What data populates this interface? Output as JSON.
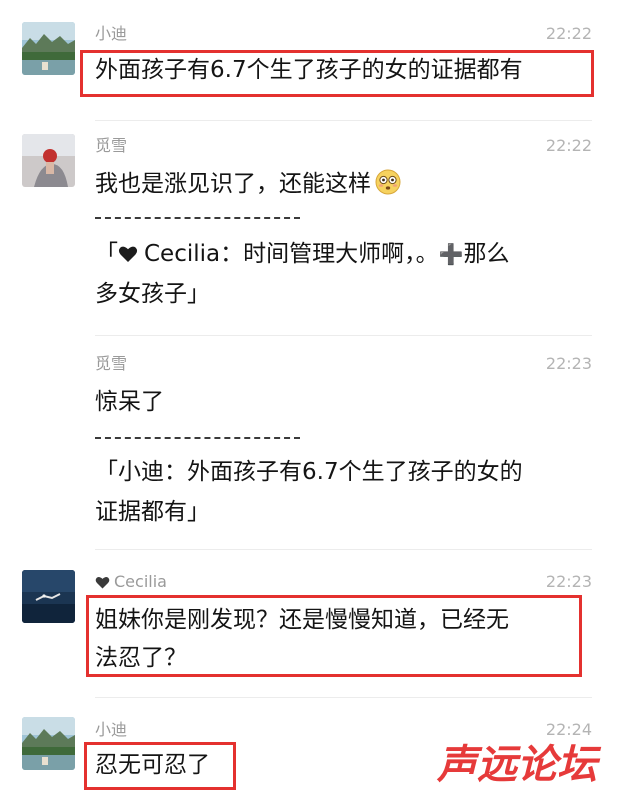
{
  "messages": [
    {
      "sender": "小迪",
      "time": "22:22",
      "text": "外面孩子有6.7个生了孩子的女的证据都有",
      "avatar_icon": "landscape-avatar-icon",
      "highlighted": true
    },
    {
      "sender": "觅雪",
      "time": "22:22",
      "text": "我也是涨见识了，还能这样",
      "emoji_icon": "flushed-face-emoji-icon",
      "divider": "---------------",
      "quote_line1_prefix": "「",
      "quote_line1_name": "Cecilia：时间管理大师啊，。",
      "quote_line1_plus": "➕",
      "quote_line1_rest": "那么",
      "quote_line2": "多女孩子」",
      "avatar_icon": "portrait-avatar-icon"
    },
    {
      "sender": "觅雪",
      "time": "22:23",
      "text": "惊呆了",
      "divider": "---------------",
      "quote_line1": "「小迪：外面孩子有6.7个生了孩子的女的",
      "quote_line2": "证据都有」"
    },
    {
      "sender": "Cecilia",
      "sender_icon": "black-heart-icon",
      "time": "22:23",
      "text_line1": "姐妹你是刚发现？还是慢慢知道，已经无",
      "text_line2": "法忍了？",
      "avatar_icon": "ocean-avatar-icon",
      "highlighted": true
    },
    {
      "sender": "小迪",
      "time": "22:24",
      "text": "忍无可忍了",
      "avatar_icon": "landscape-avatar-icon",
      "highlighted": true
    }
  ],
  "watermark": "声远论坛",
  "colors": {
    "highlight": "#e4312f",
    "watermark": "#e63a3a",
    "name": "#9a9a9a",
    "time": "#b4b4b4",
    "text": "#141414"
  }
}
